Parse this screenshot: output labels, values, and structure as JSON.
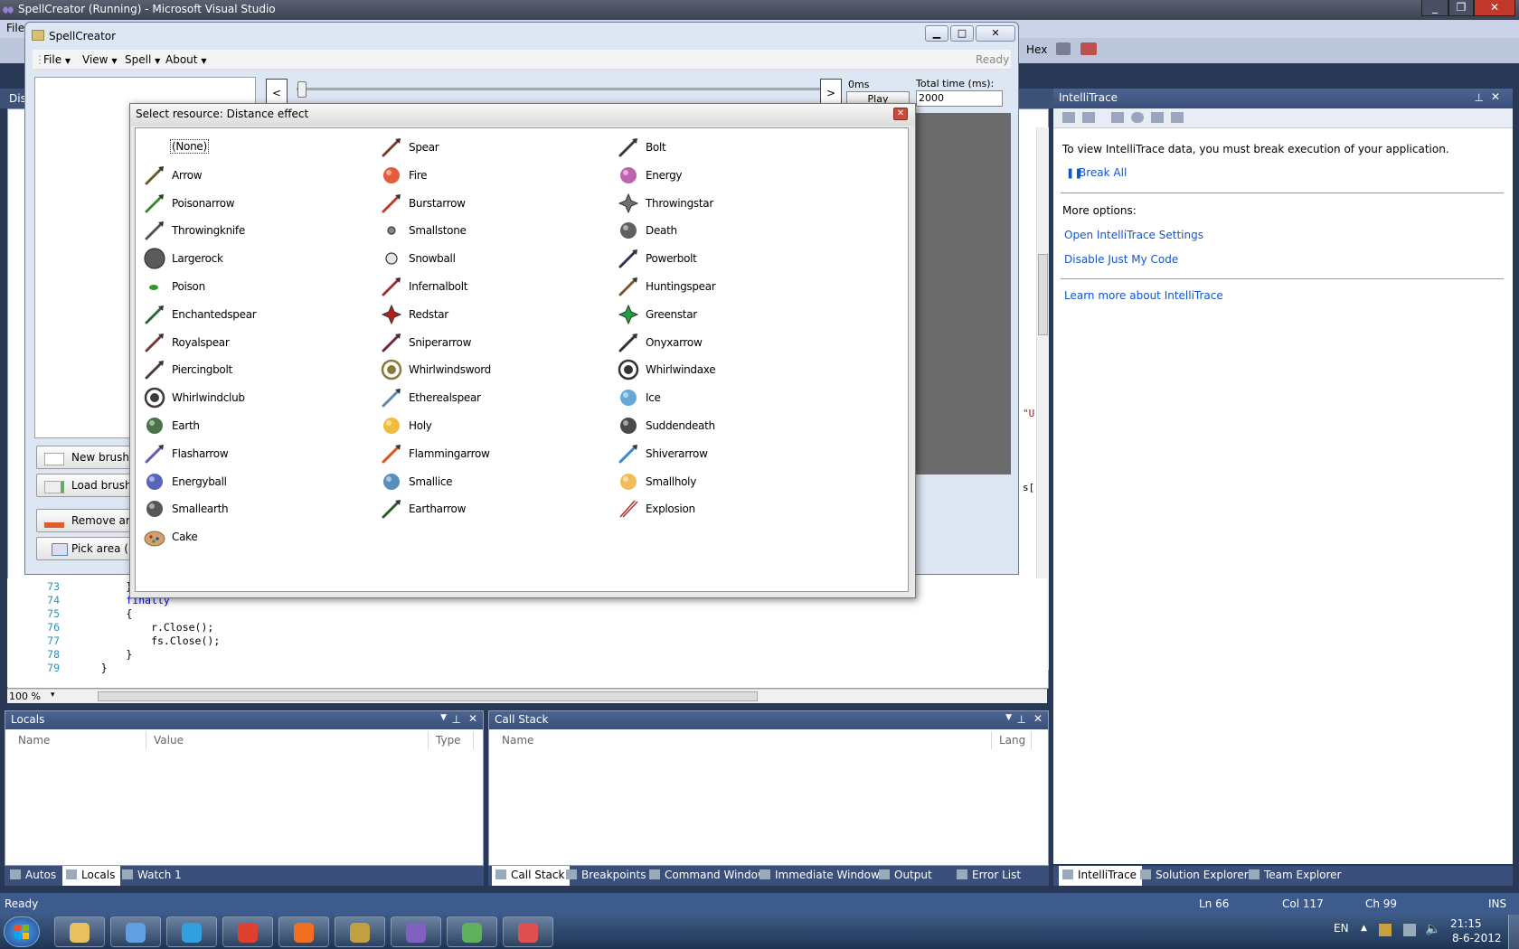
{
  "vs": {
    "title": "SpellCreator (Running) - Microsoft Visual Studio",
    "menu_first": "File",
    "toolbar_hex": "Hex",
    "tab_first": "Dis"
  },
  "spellcreator": {
    "title": "SpellCreator",
    "menu": [
      "File",
      "View",
      "Spell",
      "About"
    ],
    "status": "Ready",
    "prev_button": "<",
    "next_button": ">",
    "time_label": "0ms",
    "play_button": "Play",
    "total_time_label": "Total time (ms):",
    "total_time_value": "2000",
    "buttons": [
      "New brush",
      "Load brush",
      "Remove area",
      "Pick area (E)"
    ]
  },
  "dialog": {
    "title": "Select resource: Distance effect",
    "items": [
      [
        {
          "label": "(None)",
          "icon": "none",
          "color": "#ffffff"
        },
        {
          "label": "Spear",
          "icon": "spear",
          "color": "#7a3a2a"
        },
        {
          "label": "Bolt",
          "icon": "bolt",
          "color": "#3a3a3a"
        }
      ],
      [
        {
          "label": "Arrow",
          "icon": "arrow",
          "color": "#6a5a2a"
        },
        {
          "label": "Fire",
          "icon": "fire",
          "color": "#e0401a"
        },
        {
          "label": "Energy",
          "icon": "energy",
          "color": "#b04aa0"
        }
      ],
      [
        {
          "label": "Poisonarrow",
          "icon": "poison-arrow",
          "color": "#3a8a2a"
        },
        {
          "label": "Burstarrow",
          "icon": "burst-arrow",
          "color": "#c0392b"
        },
        {
          "label": "Throwingstar",
          "icon": "throwing-star",
          "color": "#707070"
        }
      ],
      [
        {
          "label": "Throwingknife",
          "icon": "throwing-knife",
          "color": "#555555"
        },
        {
          "label": "Smallstone",
          "icon": "small-stone",
          "color": "#888888"
        },
        {
          "label": "Death",
          "icon": "death",
          "color": "#444444"
        }
      ],
      [
        {
          "label": "Largerock",
          "icon": "large-rock",
          "color": "#5a5a5a"
        },
        {
          "label": "Snowball",
          "icon": "snowball",
          "color": "#e6e6e6"
        },
        {
          "label": "Powerbolt",
          "icon": "powerbolt",
          "color": "#303050"
        }
      ],
      [
        {
          "label": "Poison",
          "icon": "poison",
          "color": "#2a9a2a"
        },
        {
          "label": "Infernalbolt",
          "icon": "infernal-bolt",
          "color": "#a03030"
        },
        {
          "label": "Huntingspear",
          "icon": "hunting-spear",
          "color": "#7a5a2a"
        }
      ],
      [
        {
          "label": "Enchantedspear",
          "icon": "enchanted-spear",
          "color": "#2a6a3a"
        },
        {
          "label": "Redstar",
          "icon": "red-star",
          "color": "#b02020"
        },
        {
          "label": "Greenstar",
          "icon": "green-star",
          "color": "#20a040"
        }
      ],
      [
        {
          "label": "Royalspear",
          "icon": "royal-spear",
          "color": "#7a3a3a"
        },
        {
          "label": "Sniperarrow",
          "icon": "sniper-arrow",
          "color": "#6a2a3a"
        },
        {
          "label": "Onyxarrow",
          "icon": "onyx-arrow",
          "color": "#333333"
        }
      ],
      [
        {
          "label": "Piercingbolt",
          "icon": "piercing-bolt",
          "color": "#4a3a3a"
        },
        {
          "label": "Whirlwindsword",
          "icon": "whirlwind-sword",
          "color": "#8a7a3a"
        },
        {
          "label": "Whirlwindaxe",
          "icon": "whirlwind-axe",
          "color": "#333333"
        }
      ],
      [
        {
          "label": "Whirlwindclub",
          "icon": "whirlwind-club",
          "color": "#3a3a3a"
        },
        {
          "label": "Etherealspear",
          "icon": "ethereal-spear",
          "color": "#5a8aaa"
        },
        {
          "label": "Ice",
          "icon": "ice",
          "color": "#4a9ad0"
        }
      ],
      [
        {
          "label": "Earth",
          "icon": "earth",
          "color": "#2a5a2a"
        },
        {
          "label": "Holy",
          "icon": "holy",
          "color": "#f0b020"
        },
        {
          "label": "Suddendeath",
          "icon": "sudden-death",
          "color": "#2a2a2a"
        }
      ],
      [
        {
          "label": "Flasharrow",
          "icon": "flash-arrow",
          "color": "#6a5aaa"
        },
        {
          "label": "Flammingarrow",
          "icon": "flamming-arrow",
          "color": "#e05020"
        },
        {
          "label": "Shiverarrow",
          "icon": "shiver-arrow",
          "color": "#3a8ad0"
        }
      ],
      [
        {
          "label": "Energyball",
          "icon": "energy-ball",
          "color": "#3a4ab0"
        },
        {
          "label": "Smallice",
          "icon": "small-ice",
          "color": "#3a7ab0"
        },
        {
          "label": "Smallholy",
          "icon": "small-holy",
          "color": "#f0b040"
        }
      ],
      [
        {
          "label": "Smallearth",
          "icon": "small-earth",
          "color": "#3a3a3a"
        },
        {
          "label": "Eartharrow",
          "icon": "earth-arrow",
          "color": "#2a5a2a"
        },
        {
          "label": "Explosion",
          "icon": "explosion",
          "color": "#b03030"
        }
      ],
      [
        {
          "label": "Cake",
          "icon": "cake",
          "color": "#d0a070"
        }
      ]
    ]
  },
  "code": {
    "lines": [
      {
        "n": "73",
        "t": "        }"
      },
      {
        "n": "74",
        "t": "        finally"
      },
      {
        "n": "75",
        "t": "        {"
      },
      {
        "n": "76",
        "t": "            r.Close();"
      },
      {
        "n": "77",
        "t": "            fs.Close();"
      },
      {
        "n": "78",
        "t": "        }"
      },
      {
        "n": "79",
        "t": "    }"
      }
    ],
    "fragment_1": "\"U",
    "fragment_2": "s[",
    "zoom": "100 %"
  },
  "intellitrace": {
    "title": "IntelliTrace",
    "message": "To view IntelliTrace data, you must break execution of your application.",
    "break_all": "Break All",
    "more_options": "More options:",
    "link_settings": "Open IntelliTrace Settings",
    "link_just_my_code": "Disable Just My Code",
    "link_learn_more": "Learn more about IntelliTrace"
  },
  "locals": {
    "title": "Locals",
    "columns": [
      "Name",
      "Value",
      "Type"
    ],
    "tabs": [
      "Autos",
      "Locals",
      "Watch 1"
    ]
  },
  "callstack": {
    "title": "Call Stack",
    "columns": [
      "Name",
      "Lang"
    ],
    "tabs": [
      "Call Stack",
      "Breakpoints",
      "Command Window",
      "Immediate Window",
      "Output",
      "Error List"
    ]
  },
  "right_tabs": [
    "IntelliTrace",
    "Solution Explorer",
    "Team Explorer"
  ],
  "statusbar": {
    "left": "Ready",
    "ln": "Ln 66",
    "col": "Col 117",
    "ch": "Ch 99",
    "mode": "INS"
  },
  "taskbar": {
    "lang": "EN",
    "time": "21:15",
    "date": "8-6-2012",
    "apps": [
      "explorer",
      "messenger",
      "skype",
      "chrome",
      "xchat",
      "league",
      "vs",
      "notepad",
      "paint"
    ]
  }
}
